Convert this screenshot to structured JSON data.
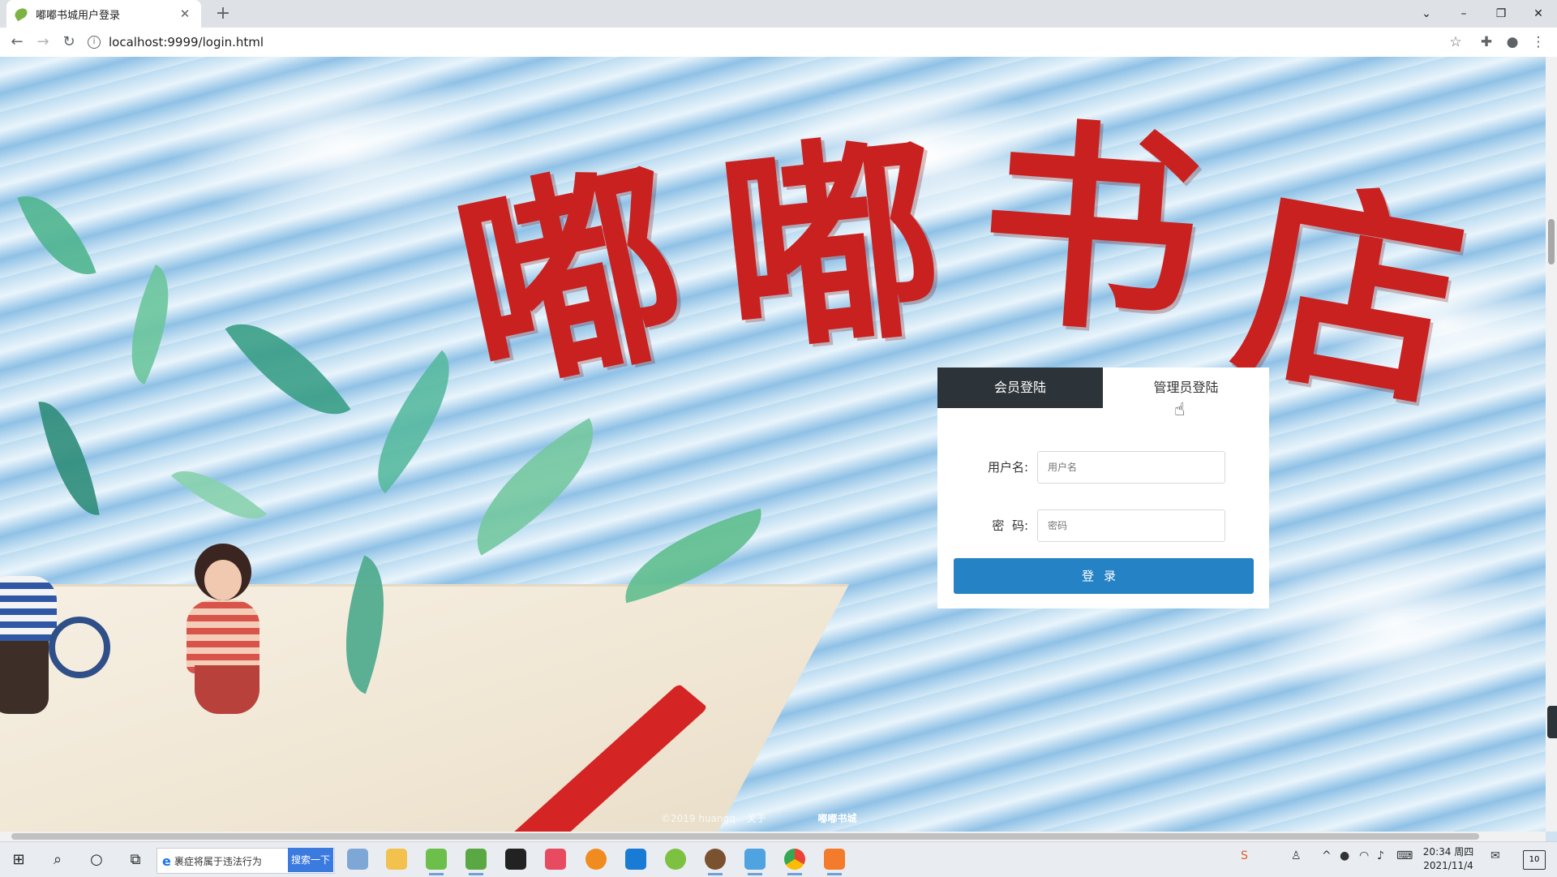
{
  "browser": {
    "tab_title": "嘟嘟书城用户登录",
    "url": "localhost:9999/login.html"
  },
  "hero": {
    "title_chars": [
      "嘟",
      "嘟",
      "书",
      "店"
    ]
  },
  "login": {
    "tab_member": "会员登陆",
    "tab_admin": "管理员登陆",
    "username_label": "用户名:",
    "username_placeholder": "用户名",
    "password_label": "密  码:",
    "password_placeholder": "密码",
    "submit_label": "登录"
  },
  "footer": {
    "copyright": "©2019 huangq",
    "about": "关于",
    "brand": "嘟嘟书城"
  },
  "taskbar": {
    "search_text": "裹症将属于违法行为",
    "search_button": "搜索一下",
    "time": "20:34 周四",
    "date": "2021/11/4",
    "notification_count": "10"
  },
  "colors": {
    "title_red": "#c8211f",
    "active_tab_bg": "#2d3439",
    "login_button": "#2583c5"
  }
}
